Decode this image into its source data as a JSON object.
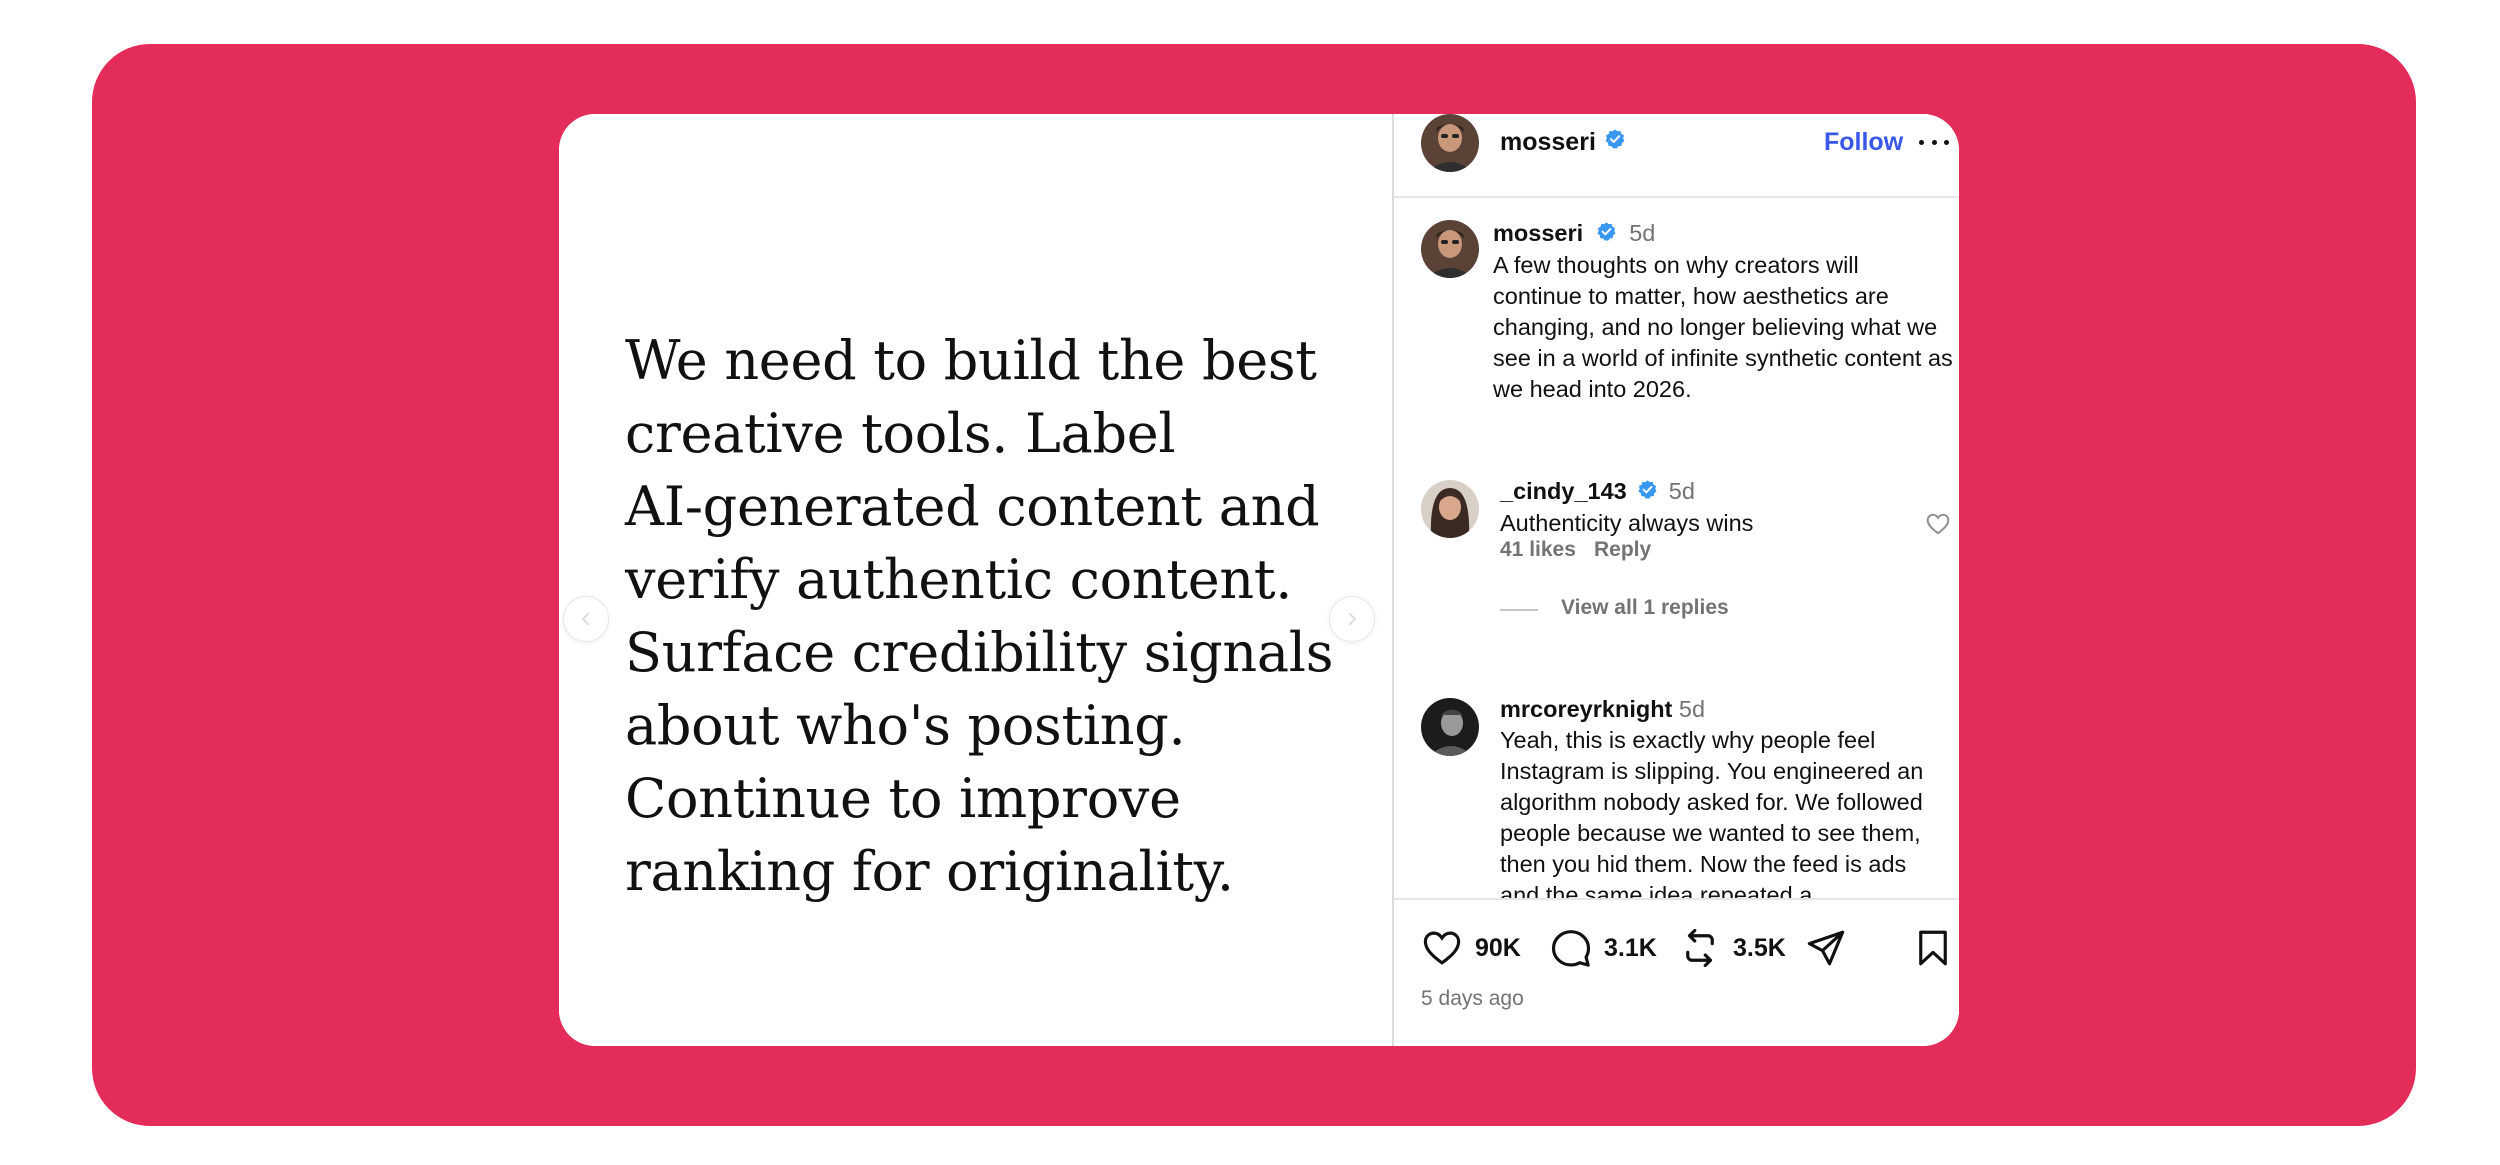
{
  "post": {
    "slide_text": "We need to build the best\ncreative tools. Label\nAI-generated content and\nverify authentic content.\nSurface credibility signals\nabout who's posting.\nContinue to improve\nranking for originality."
  },
  "header": {
    "username": "mosseri",
    "follow_label": "Follow"
  },
  "caption": {
    "username": "mosseri",
    "time": "5d",
    "text": "A few thoughts on why creators will continue to matter, how aesthetics are changing, and no longer believing what we see in a world of infinite synthetic content as we head into 2026."
  },
  "comments": [
    {
      "username": "_cindy_143",
      "time": "5d",
      "text": "Authenticity always wins",
      "likes": "41 likes",
      "reply_label": "Reply",
      "view_replies": "View all 1 replies"
    },
    {
      "username": "mrcoreyrknight",
      "time": "5d",
      "text": "Yeah, this is exactly why people feel Instagram is slipping. You engineered an algorithm nobody asked for. We followed people because we wanted to see them, then you hid them. Now the feed is ads and the same idea repeated a"
    }
  ],
  "actions": {
    "likes": "90K",
    "comments": "3.1K",
    "reposts": "3.5K"
  },
  "posted_ago": "5 days ago",
  "icons": {
    "verified": "verified-badge-icon",
    "like": "heart-icon",
    "comment": "comment-bubble-icon",
    "repost": "repost-icon",
    "share": "send-icon",
    "save": "bookmark-icon",
    "more": "more-icon"
  },
  "colors": {
    "frame": "#e32c59",
    "link": "#3a57e8",
    "verified": "#3897f0",
    "muted": "#737373"
  }
}
